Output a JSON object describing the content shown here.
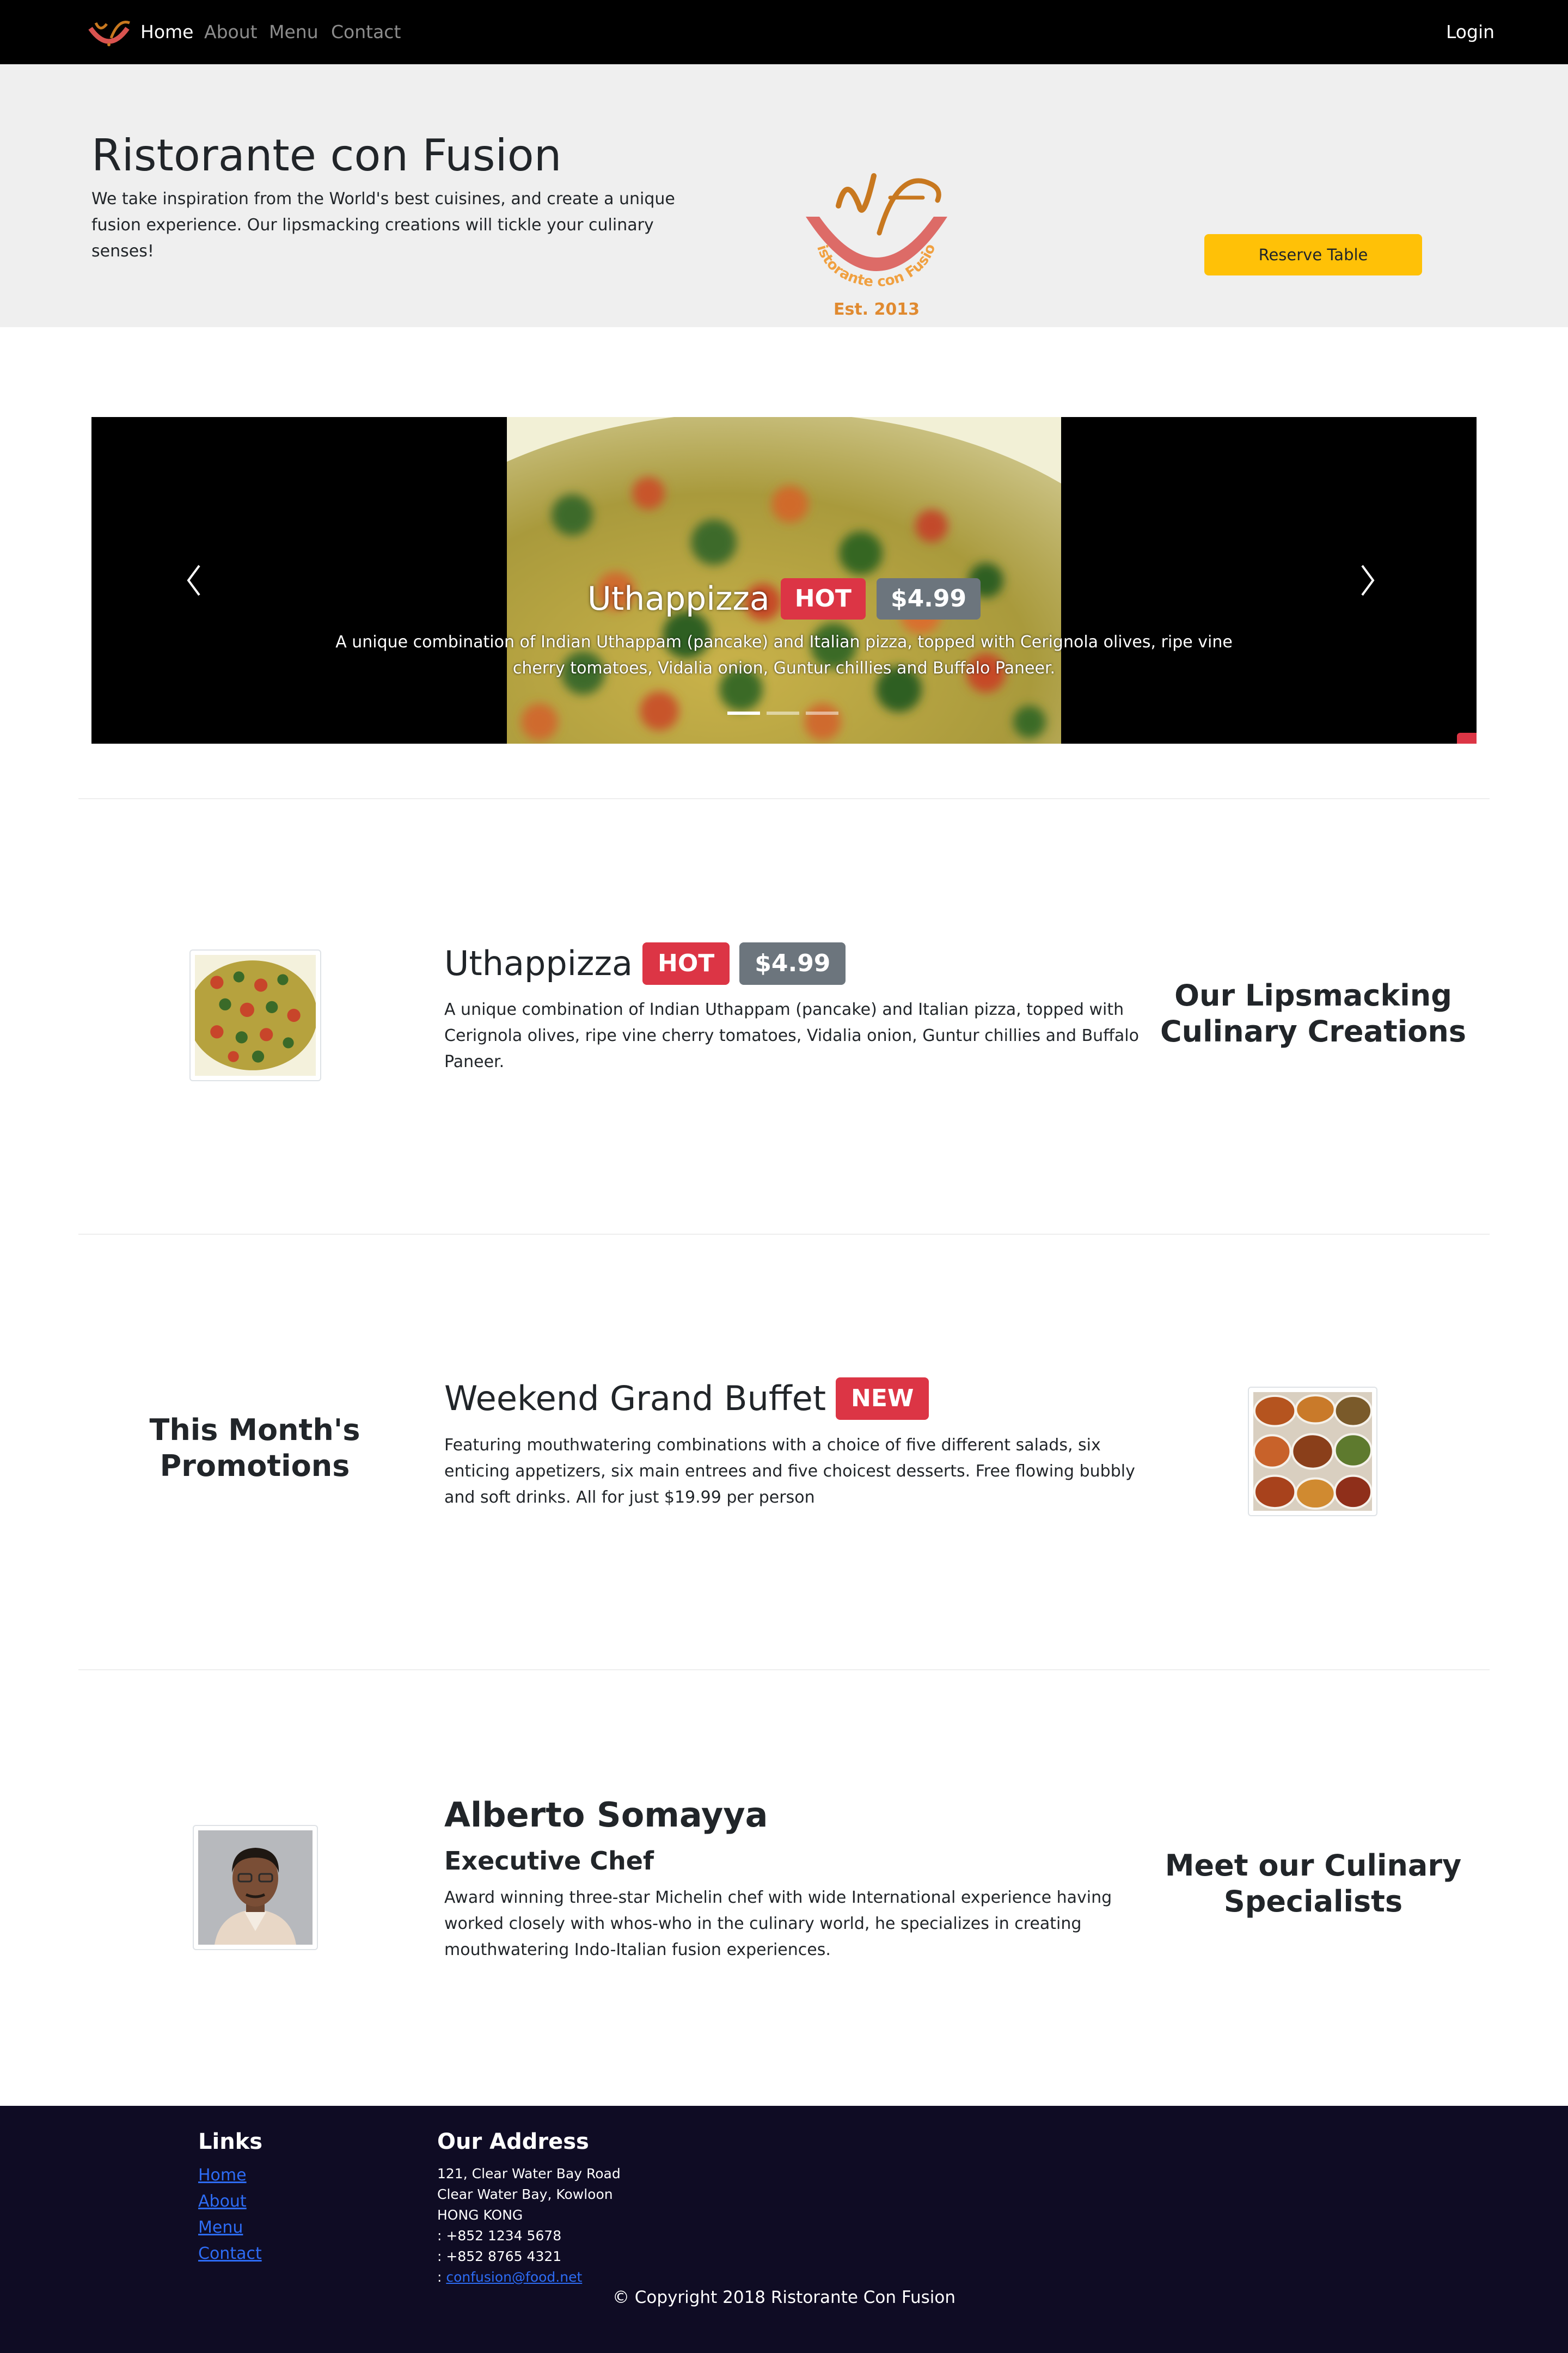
{
  "navbar": {
    "links": [
      "Home",
      "About",
      "Menu",
      "Contact"
    ],
    "active": "Home",
    "login_label": "Login"
  },
  "jumbotron": {
    "title": "Ristorante con Fusion",
    "text": "We take inspiration from the World's best cuisines, and create a unique fusion experience. Our lipsmacking creations will tickle your culinary senses!",
    "reserve_label": "Reserve Table",
    "logo_text": "Ristorante con Fusion",
    "logo_est": "Est. 2013"
  },
  "carousel": {
    "title": "Uthappizza",
    "badge_hot": "HOT",
    "badge_price": "$4.99",
    "description": "A unique combination of Indian Uthappam (pancake) and Italian pizza, topped with Cerignola olives, ripe vine cherry tomatoes, Vidalia onion, Guntur chillies and Buffalo Paneer.",
    "slide_count": 3,
    "active_slide": 1
  },
  "dish": {
    "title": "Uthappizza",
    "badge_hot": "HOT",
    "badge_price": "$4.99",
    "description": "A unique combination of Indian Uthappam (pancake) and Italian pizza, topped with Cerignola olives, ripe vine cherry tomatoes, Vidalia onion, Guntur chillies and Buffalo Paneer.",
    "side_heading": "Our Lipsmacking Culinary Creations"
  },
  "promotion": {
    "title": "Weekend Grand Buffet",
    "badge_new": "NEW",
    "description": "Featuring mouthwatering combinations with a choice of five different salads, six enticing appetizers, six main entrees and five choicest desserts. Free flowing bubbly and soft drinks. All for just $19.99 per person",
    "side_heading": "This Month's Promotions"
  },
  "leader": {
    "name": "Alberto Somayya",
    "designation": "Executive Chef",
    "description": "Award winning three-star Michelin chef with wide International experience having worked closely with whos-who in the culinary world, he specializes in creating mouthwatering Indo-Italian fusion experiences.",
    "side_heading": "Meet our Culinary Specialists"
  },
  "footer": {
    "links_heading": "Links",
    "links": [
      "Home",
      "About",
      "Menu",
      "Contact"
    ],
    "address_heading": "Our Address",
    "address_line1": "121, Clear Water Bay Road",
    "address_line2": "Clear Water Bay, Kowloon",
    "address_line3": "HONG KONG",
    "phone1": ": +852 1234 5678",
    "phone2": ": +852 8765 4321",
    "email_prefix": ": ",
    "email": "confusion@food.net",
    "copyright": "© Copyright 2018 Ristorante Con Fusion"
  },
  "colors": {
    "navbar_bg": "#000000",
    "jumbotron_bg": "#efefef",
    "reserve_button": "#ffc107",
    "badge_hot": "#dc3545",
    "badge_price": "#6c757d",
    "footer_bg": "#0f0c24",
    "link": "#2d6cf5"
  }
}
